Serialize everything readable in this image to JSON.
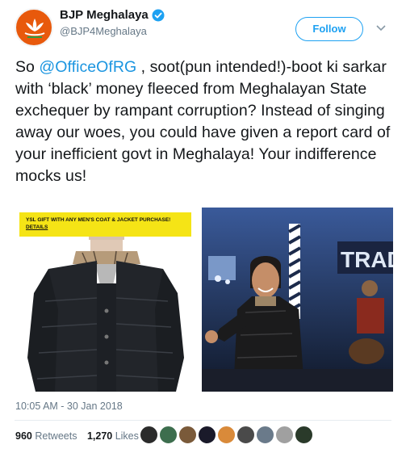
{
  "author": {
    "display_name": "BJP Meghalaya",
    "handle": "@BJP4Meghalaya",
    "verified_icon": "verified-badge-icon",
    "avatar_icon": "lotus-logo-icon"
  },
  "actions": {
    "follow_label": "Follow",
    "more_icon": "chevron-down-icon"
  },
  "tweet": {
    "text_before": "So ",
    "mention": "@OfficeOfRG",
    "text_after": " , soot(pun intended!)-boot ki sarkar with ‘black’ money fleeced from Meghalayan State exchequer by rampant corruption? Instead of singing away our woes, you could have given a report card of your inefficient govt in Meghalaya! Your indifference mocks us!"
  },
  "media": {
    "left_promo_line": "YSL GIFT WITH ANY MEN'S COAT & JACKET PURCHASE!",
    "left_promo_link": "DETAILS",
    "right_banner_text": "TRAD"
  },
  "meta": {
    "timestamp": "10:05 AM - 30 Jan 2018"
  },
  "stats": {
    "retweets_count": "960",
    "retweets_label": "Retweets",
    "likes_count": "1,270",
    "likes_label": "Likes"
  },
  "colors": {
    "link_blue": "#1b95e0",
    "follow_blue": "#1da1f2",
    "muted_gray": "#657786",
    "avatar_orange": "#e8590c",
    "promo_yellow": "#f5e416"
  }
}
